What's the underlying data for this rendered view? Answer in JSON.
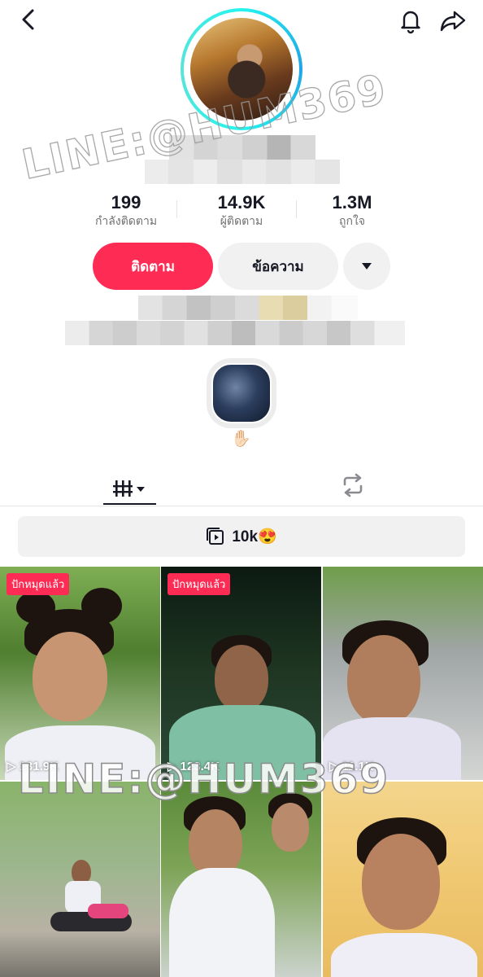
{
  "header": {
    "back_icon": "chevron-left-icon",
    "bell_icon": "bell-icon",
    "share_icon": "share-arrow-icon"
  },
  "profile": {
    "stats": [
      {
        "value": "199",
        "label": "กำลังติดตาม"
      },
      {
        "value": "14.9K",
        "label": "ผู้ติดตาม"
      },
      {
        "value": "1.3M",
        "label": "ถูกใจ"
      }
    ],
    "follow_label": "ติดตาม",
    "message_label": "ข้อความ",
    "highlight_emoji": "✋🏻"
  },
  "tabs": {
    "videos_icon": "grid-icon",
    "repost_icon": "repost-icon"
  },
  "playlist": {
    "label": "10k😍"
  },
  "videos": [
    {
      "pinned": "ปักหมุดแล้ว",
      "views": "131.9K"
    },
    {
      "pinned": "ปักหมุดแล้ว",
      "views": "123.4K"
    },
    {
      "pinned": "",
      "views": "11.1K"
    },
    {
      "pinned": "",
      "views": ""
    },
    {
      "pinned": "",
      "views": ""
    },
    {
      "pinned": "",
      "views": ""
    }
  ],
  "watermark": "LINE:@HUM369",
  "colors": {
    "accent": "#fe2c55",
    "ring": "#25f4ee",
    "button_gray": "#f1f1f2"
  }
}
